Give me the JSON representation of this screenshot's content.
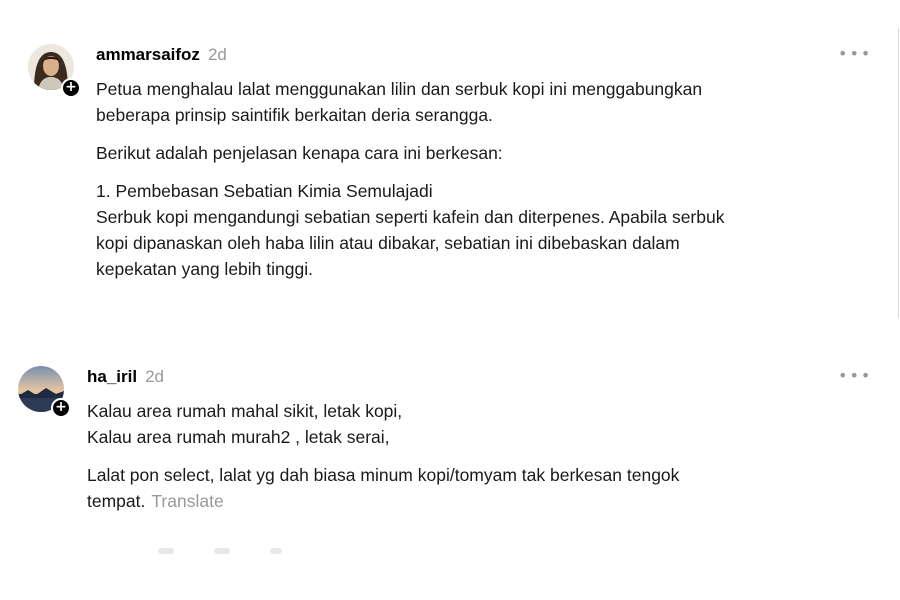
{
  "posts": [
    {
      "username": "ammarsaifoz",
      "time": "2d",
      "more": "•••",
      "paragraphs": [
        [
          "Petua menghalau lalat menggunakan lilin dan serbuk kopi ini menggabungkan",
          "beberapa prinsip saintifik berkaitan deria serangga."
        ],
        [
          "Berikut adalah penjelasan kenapa cara ini berkesan:"
        ],
        [
          "1. Pembebasan Sebatian Kimia Semulajadi",
          "Serbuk kopi mengandungi sebatian seperti kafein dan diterpenes. Apabila serbuk",
          "kopi dipanaskan oleh haba lilin atau dibakar, sebatian ini dibebaskan dalam",
          "kepekatan yang lebih tinggi."
        ]
      ]
    },
    {
      "username": "ha_iril",
      "time": "2d",
      "more": "•••",
      "paragraphs": [
        [
          "Kalau area rumah mahal sikit, letak kopi,",
          "Kalau area rumah murah2 , letak serai,"
        ],
        [
          "Lalat pon select, lalat yg dah biasa minum kopi/tomyam tak berkesan tengok",
          "tempat."
        ]
      ],
      "translate": "Translate"
    }
  ],
  "icons": {
    "follow": "+"
  }
}
